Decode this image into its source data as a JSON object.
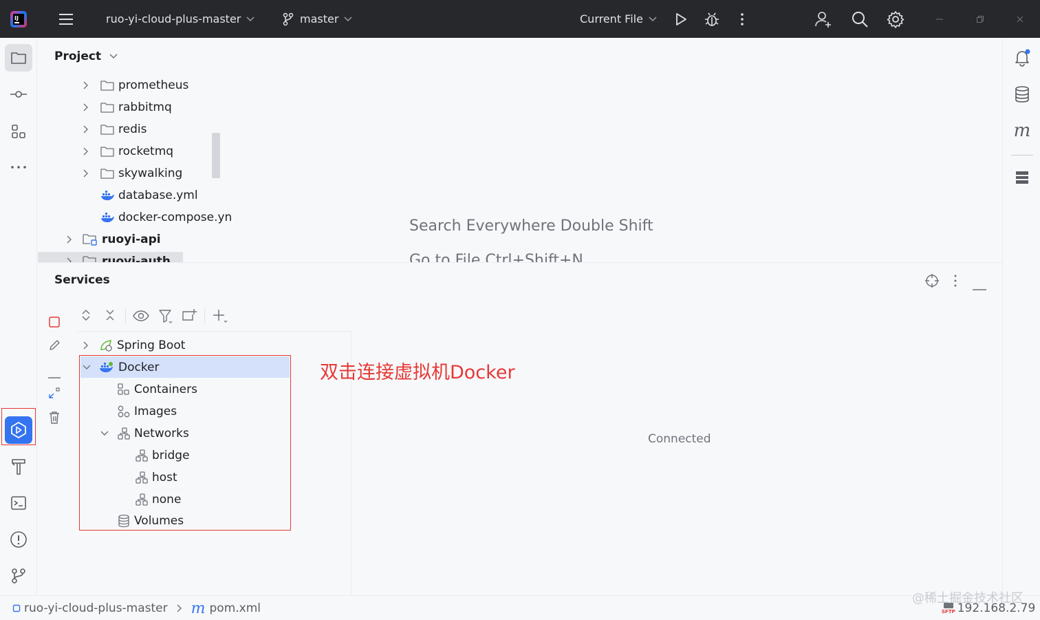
{
  "titlebar": {
    "project": "ruo-yi-cloud-plus-master",
    "branch": "master",
    "run_config": "Current File",
    "icons": [
      "intellij-logo-icon",
      "hamburger-menu-icon",
      "branch-icon",
      "run-icon",
      "debug-icon",
      "more-vert-icon",
      "add-user-icon",
      "search-icon",
      "settings-icon",
      "minimize-icon",
      "restore-icon",
      "close-icon"
    ]
  },
  "project_panel": {
    "title": "Project",
    "tree": [
      {
        "label": "prometheus",
        "type": "folder"
      },
      {
        "label": "rabbitmq",
        "type": "folder"
      },
      {
        "label": "redis",
        "type": "folder"
      },
      {
        "label": "rocketmq",
        "type": "folder"
      },
      {
        "label": "skywalking",
        "type": "folder"
      },
      {
        "label": "database.yml",
        "type": "docker-file"
      },
      {
        "label": "docker-compose.yn",
        "type": "docker-file"
      },
      {
        "label": "ruoyi-api",
        "type": "module"
      },
      {
        "label": "ruoyi-auth",
        "type": "module"
      }
    ]
  },
  "editor": {
    "hint1": "Search Everywhere Double Shift",
    "hint2": "Go to File Ctrl+Shift+N"
  },
  "services": {
    "title": "Services",
    "tree": [
      {
        "label": "Spring Boot",
        "icon": "spring-boot-icon"
      },
      {
        "label": "Docker",
        "icon": "docker-icon"
      },
      {
        "label": "Containers",
        "icon": "containers-icon"
      },
      {
        "label": "Images",
        "icon": "images-icon"
      },
      {
        "label": "Networks",
        "icon": "networks-icon"
      },
      {
        "label": "bridge",
        "icon": "network-icon"
      },
      {
        "label": "host",
        "icon": "network-icon"
      },
      {
        "label": "none",
        "icon": "network-icon"
      },
      {
        "label": "Volumes",
        "icon": "volumes-icon"
      }
    ],
    "annotation": "双击连接虚拟机Docker",
    "status": "Connected"
  },
  "statusbar": {
    "project": "ruo-yi-cloud-plus-master",
    "file": "pom.xml",
    "watermark": "@稀土掘金技术社区",
    "sftp_label": "SFTP",
    "ip": "192.168.2.79"
  },
  "colors": {
    "accent": "#3574f0",
    "annotation": "#e53935",
    "titlebar": "#27282c",
    "selection": "#d5e1fb"
  }
}
